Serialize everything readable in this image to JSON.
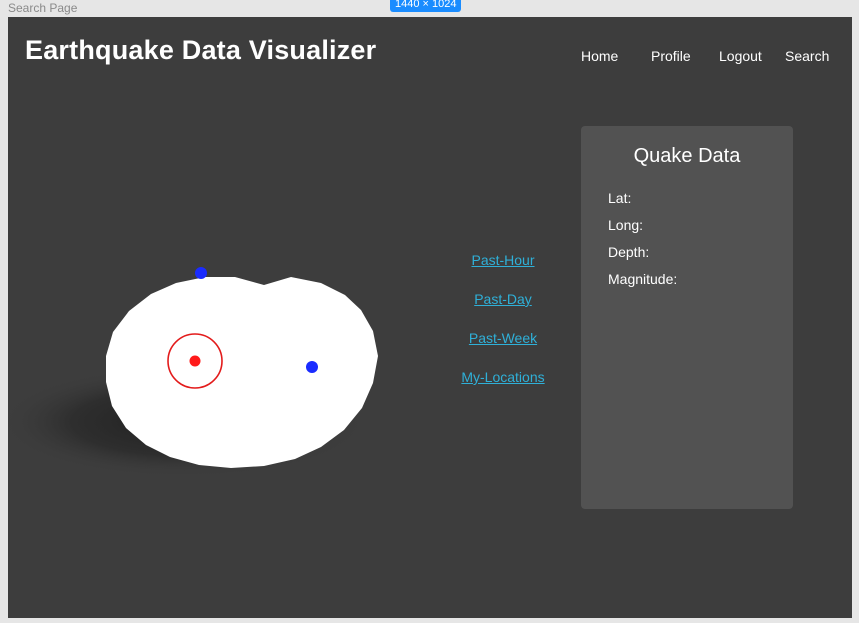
{
  "canvas": {
    "page_label": "Search Page",
    "size_badge": "1440 × 1024"
  },
  "header": {
    "title": "Earthquake Data Visualizer"
  },
  "nav": {
    "items": [
      {
        "label": "Home"
      },
      {
        "label": "Profile"
      },
      {
        "label": "Logout"
      },
      {
        "label": "Search"
      }
    ]
  },
  "time_filters": {
    "items": [
      {
        "label": "Past-Hour"
      },
      {
        "label": "Past-Day"
      },
      {
        "label": "Past-Week"
      },
      {
        "label": "My-Locations"
      }
    ]
  },
  "quake_panel": {
    "title": "Quake Data",
    "fields": [
      {
        "label": "Lat:",
        "value": ""
      },
      {
        "label": "Long:",
        "value": ""
      },
      {
        "label": "Depth:",
        "value": ""
      },
      {
        "label": "Magnitude:",
        "value": ""
      }
    ]
  },
  "globe": {
    "markers": [
      {
        "kind": "quake",
        "color": "#1a2cff",
        "selected": false
      },
      {
        "kind": "quake",
        "color": "#ff1a1a",
        "selected": true
      },
      {
        "kind": "quake",
        "color": "#1a2cff",
        "selected": false
      }
    ]
  },
  "colors": {
    "background": "#3d3d3d",
    "panel": "#525252",
    "link": "#2fb0d8",
    "badge": "#1a8cff",
    "selected_marker": "#ff1a1a",
    "marker": "#1a2cff"
  }
}
